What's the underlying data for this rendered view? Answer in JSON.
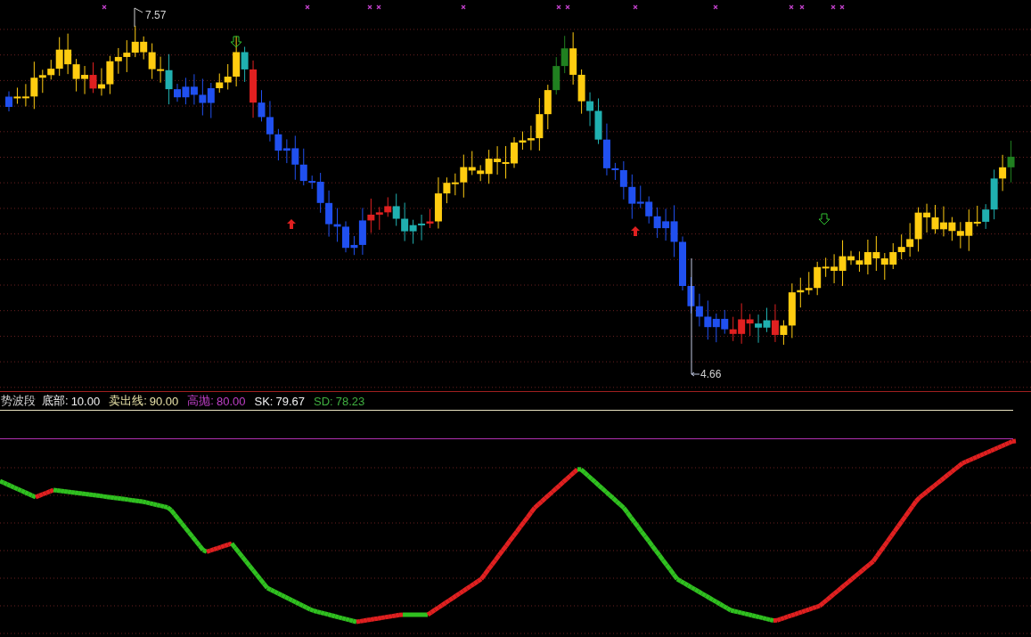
{
  "indicator": {
    "title": "势波段",
    "legend": [
      {
        "label": "底部:",
        "value": "10.00",
        "color": "#f0f0f0"
      },
      {
        "label": "卖出线:",
        "value": "90.00",
        "color": "#e8e2a8"
      },
      {
        "label": "高抛:",
        "value": "80.00",
        "color": "#c040c8"
      },
      {
        "label": "SK:",
        "value": "79.67",
        "color": "#f0f0f0"
      },
      {
        "label": "SD:",
        "value": "78.23",
        "color": "#40b040"
      }
    ]
  },
  "price_chart": {
    "high_label": "7.57",
    "low_label": "4.66"
  }
}
